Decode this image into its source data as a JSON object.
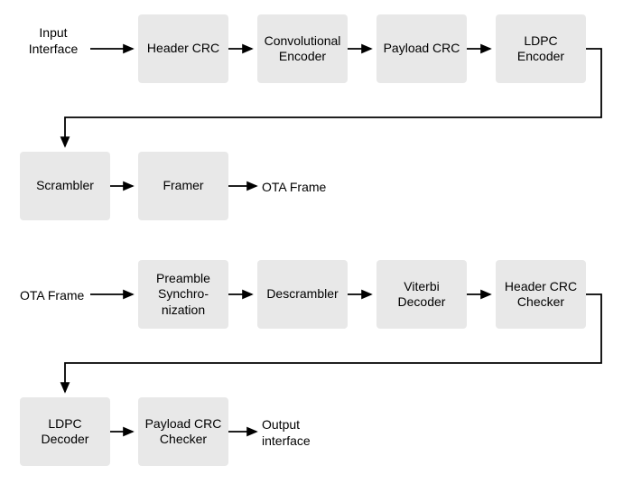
{
  "labels": {
    "input_interface": "Input Interface",
    "ota_frame_out": "OTA Frame",
    "ota_frame_in": "OTA Frame",
    "output_interface": "Output interface"
  },
  "boxes": {
    "header_crc": "Header CRC",
    "conv_encoder": "Convolutional Encoder",
    "payload_crc": "Payload CRC",
    "ldpc_encoder": "LDPC Encoder",
    "scrambler": "Scrambler",
    "framer": "Framer",
    "preamble_sync": "Preamble Synchro‐nization",
    "descrambler": "Descrambler",
    "viterbi_decoder": "Viterbi Decoder",
    "header_crc_checker": "Header CRC Checker",
    "ldpc_decoder": "LDPC Decoder",
    "payload_crc_checker": "Payload CRC Checker"
  }
}
